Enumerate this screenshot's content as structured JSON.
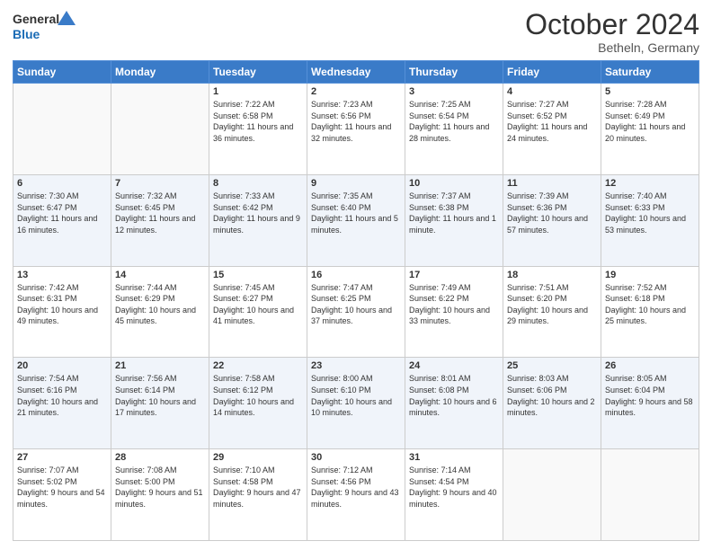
{
  "header": {
    "logo_general": "General",
    "logo_blue": "Blue",
    "month": "October 2024",
    "location": "Betheln, Germany"
  },
  "days_of_week": [
    "Sunday",
    "Monday",
    "Tuesday",
    "Wednesday",
    "Thursday",
    "Friday",
    "Saturday"
  ],
  "weeks": [
    [
      {
        "day": "",
        "sunrise": "",
        "sunset": "",
        "daylight": ""
      },
      {
        "day": "",
        "sunrise": "",
        "sunset": "",
        "daylight": ""
      },
      {
        "day": "1",
        "sunrise": "Sunrise: 7:22 AM",
        "sunset": "Sunset: 6:58 PM",
        "daylight": "Daylight: 11 hours and 36 minutes."
      },
      {
        "day": "2",
        "sunrise": "Sunrise: 7:23 AM",
        "sunset": "Sunset: 6:56 PM",
        "daylight": "Daylight: 11 hours and 32 minutes."
      },
      {
        "day": "3",
        "sunrise": "Sunrise: 7:25 AM",
        "sunset": "Sunset: 6:54 PM",
        "daylight": "Daylight: 11 hours and 28 minutes."
      },
      {
        "day": "4",
        "sunrise": "Sunrise: 7:27 AM",
        "sunset": "Sunset: 6:52 PM",
        "daylight": "Daylight: 11 hours and 24 minutes."
      },
      {
        "day": "5",
        "sunrise": "Sunrise: 7:28 AM",
        "sunset": "Sunset: 6:49 PM",
        "daylight": "Daylight: 11 hours and 20 minutes."
      }
    ],
    [
      {
        "day": "6",
        "sunrise": "Sunrise: 7:30 AM",
        "sunset": "Sunset: 6:47 PM",
        "daylight": "Daylight: 11 hours and 16 minutes."
      },
      {
        "day": "7",
        "sunrise": "Sunrise: 7:32 AM",
        "sunset": "Sunset: 6:45 PM",
        "daylight": "Daylight: 11 hours and 12 minutes."
      },
      {
        "day": "8",
        "sunrise": "Sunrise: 7:33 AM",
        "sunset": "Sunset: 6:42 PM",
        "daylight": "Daylight: 11 hours and 9 minutes."
      },
      {
        "day": "9",
        "sunrise": "Sunrise: 7:35 AM",
        "sunset": "Sunset: 6:40 PM",
        "daylight": "Daylight: 11 hours and 5 minutes."
      },
      {
        "day": "10",
        "sunrise": "Sunrise: 7:37 AM",
        "sunset": "Sunset: 6:38 PM",
        "daylight": "Daylight: 11 hours and 1 minute."
      },
      {
        "day": "11",
        "sunrise": "Sunrise: 7:39 AM",
        "sunset": "Sunset: 6:36 PM",
        "daylight": "Daylight: 10 hours and 57 minutes."
      },
      {
        "day": "12",
        "sunrise": "Sunrise: 7:40 AM",
        "sunset": "Sunset: 6:33 PM",
        "daylight": "Daylight: 10 hours and 53 minutes."
      }
    ],
    [
      {
        "day": "13",
        "sunrise": "Sunrise: 7:42 AM",
        "sunset": "Sunset: 6:31 PM",
        "daylight": "Daylight: 10 hours and 49 minutes."
      },
      {
        "day": "14",
        "sunrise": "Sunrise: 7:44 AM",
        "sunset": "Sunset: 6:29 PM",
        "daylight": "Daylight: 10 hours and 45 minutes."
      },
      {
        "day": "15",
        "sunrise": "Sunrise: 7:45 AM",
        "sunset": "Sunset: 6:27 PM",
        "daylight": "Daylight: 10 hours and 41 minutes."
      },
      {
        "day": "16",
        "sunrise": "Sunrise: 7:47 AM",
        "sunset": "Sunset: 6:25 PM",
        "daylight": "Daylight: 10 hours and 37 minutes."
      },
      {
        "day": "17",
        "sunrise": "Sunrise: 7:49 AM",
        "sunset": "Sunset: 6:22 PM",
        "daylight": "Daylight: 10 hours and 33 minutes."
      },
      {
        "day": "18",
        "sunrise": "Sunrise: 7:51 AM",
        "sunset": "Sunset: 6:20 PM",
        "daylight": "Daylight: 10 hours and 29 minutes."
      },
      {
        "day": "19",
        "sunrise": "Sunrise: 7:52 AM",
        "sunset": "Sunset: 6:18 PM",
        "daylight": "Daylight: 10 hours and 25 minutes."
      }
    ],
    [
      {
        "day": "20",
        "sunrise": "Sunrise: 7:54 AM",
        "sunset": "Sunset: 6:16 PM",
        "daylight": "Daylight: 10 hours and 21 minutes."
      },
      {
        "day": "21",
        "sunrise": "Sunrise: 7:56 AM",
        "sunset": "Sunset: 6:14 PM",
        "daylight": "Daylight: 10 hours and 17 minutes."
      },
      {
        "day": "22",
        "sunrise": "Sunrise: 7:58 AM",
        "sunset": "Sunset: 6:12 PM",
        "daylight": "Daylight: 10 hours and 14 minutes."
      },
      {
        "day": "23",
        "sunrise": "Sunrise: 8:00 AM",
        "sunset": "Sunset: 6:10 PM",
        "daylight": "Daylight: 10 hours and 10 minutes."
      },
      {
        "day": "24",
        "sunrise": "Sunrise: 8:01 AM",
        "sunset": "Sunset: 6:08 PM",
        "daylight": "Daylight: 10 hours and 6 minutes."
      },
      {
        "day": "25",
        "sunrise": "Sunrise: 8:03 AM",
        "sunset": "Sunset: 6:06 PM",
        "daylight": "Daylight: 10 hours and 2 minutes."
      },
      {
        "day": "26",
        "sunrise": "Sunrise: 8:05 AM",
        "sunset": "Sunset: 6:04 PM",
        "daylight": "Daylight: 9 hours and 58 minutes."
      }
    ],
    [
      {
        "day": "27",
        "sunrise": "Sunrise: 7:07 AM",
        "sunset": "Sunset: 5:02 PM",
        "daylight": "Daylight: 9 hours and 54 minutes."
      },
      {
        "day": "28",
        "sunrise": "Sunrise: 7:08 AM",
        "sunset": "Sunset: 5:00 PM",
        "daylight": "Daylight: 9 hours and 51 minutes."
      },
      {
        "day": "29",
        "sunrise": "Sunrise: 7:10 AM",
        "sunset": "Sunset: 4:58 PM",
        "daylight": "Daylight: 9 hours and 47 minutes."
      },
      {
        "day": "30",
        "sunrise": "Sunrise: 7:12 AM",
        "sunset": "Sunset: 4:56 PM",
        "daylight": "Daylight: 9 hours and 43 minutes."
      },
      {
        "day": "31",
        "sunrise": "Sunrise: 7:14 AM",
        "sunset": "Sunset: 4:54 PM",
        "daylight": "Daylight: 9 hours and 40 minutes."
      },
      {
        "day": "",
        "sunrise": "",
        "sunset": "",
        "daylight": ""
      },
      {
        "day": "",
        "sunrise": "",
        "sunset": "",
        "daylight": ""
      }
    ]
  ]
}
